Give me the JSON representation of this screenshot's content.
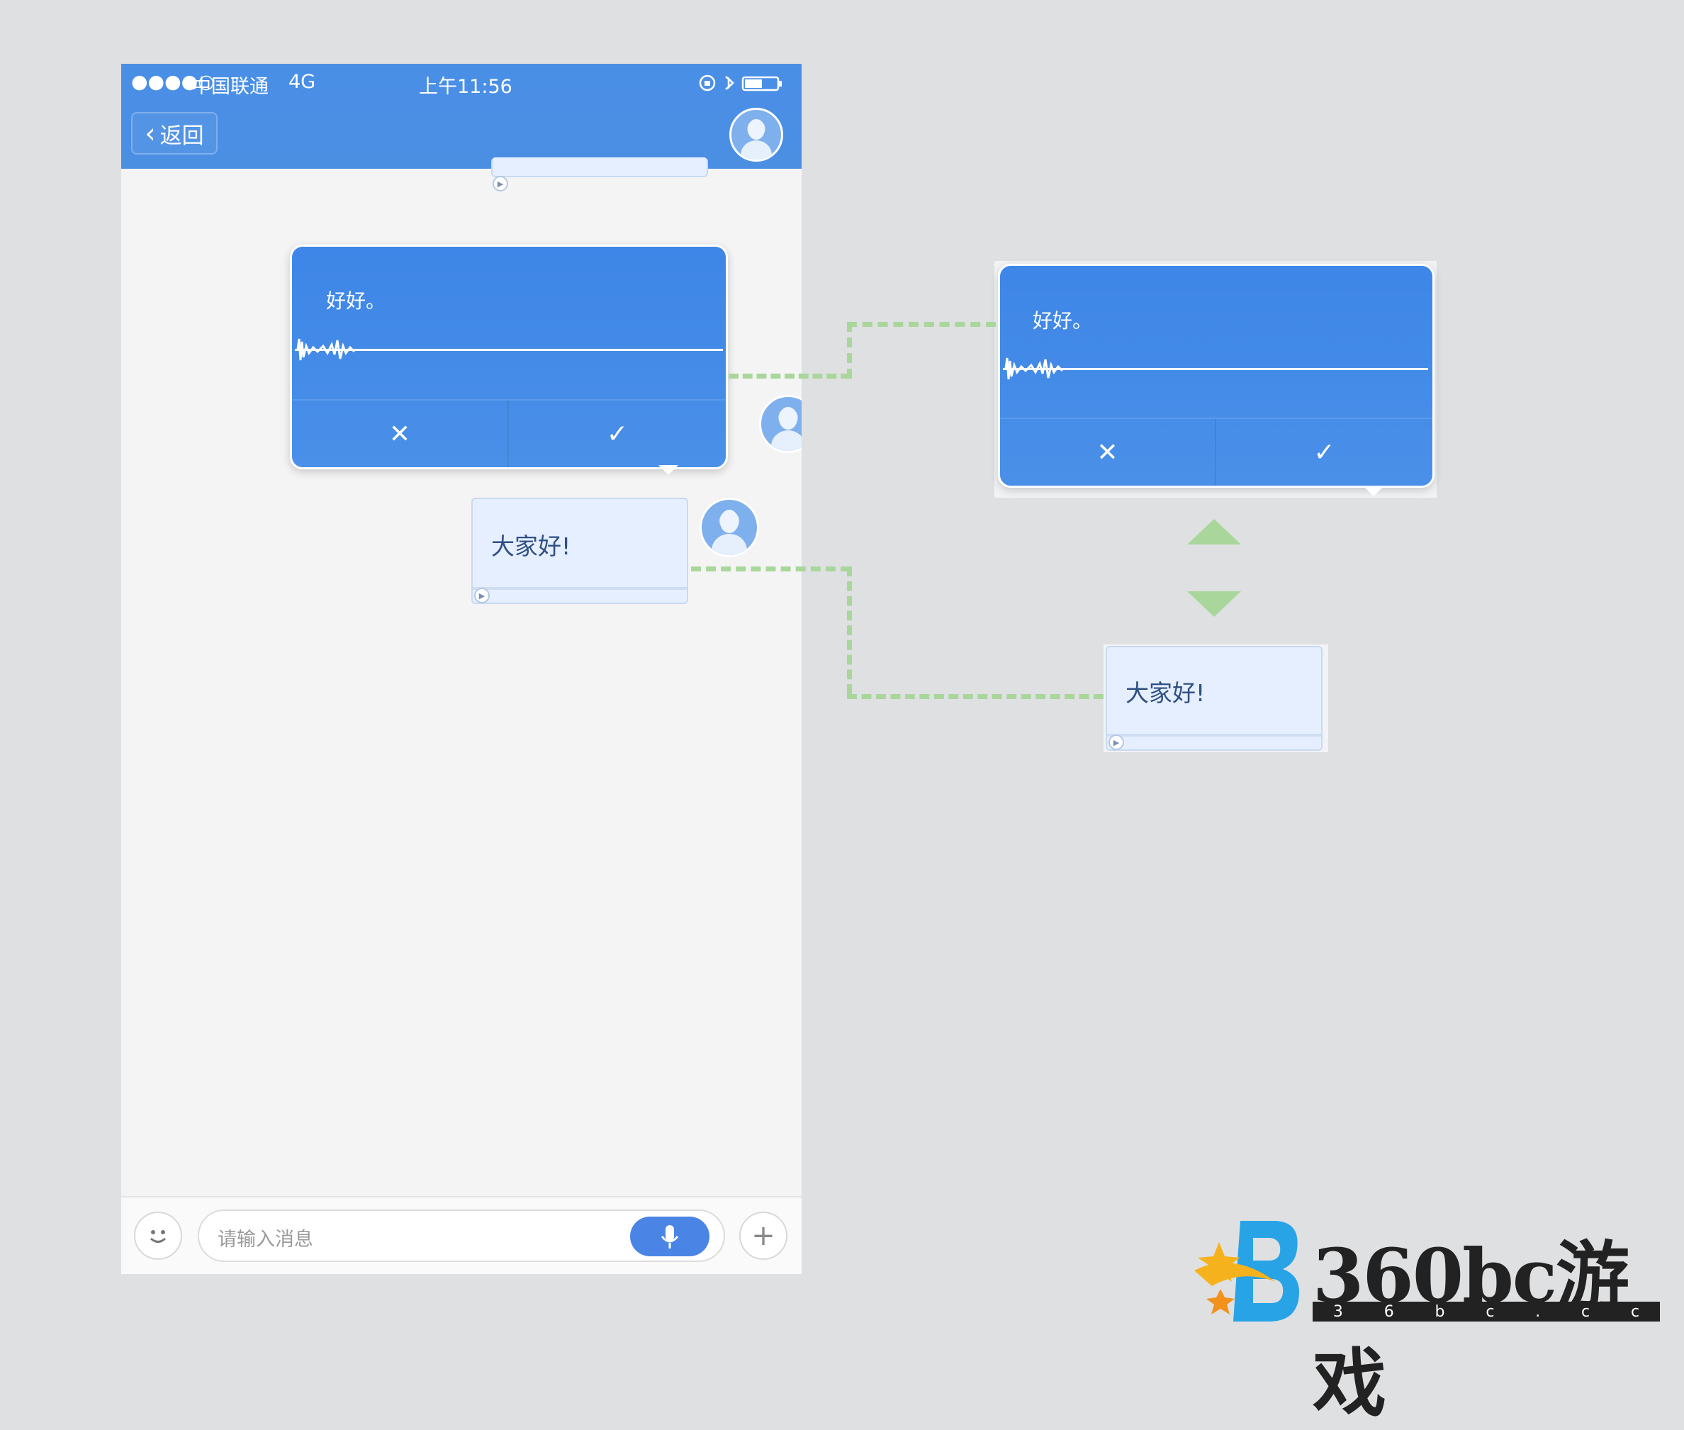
{
  "status_bar": {
    "signal": "●●●●○",
    "carrier": "中国联通",
    "network": "4G",
    "time": "上午11:56"
  },
  "nav": {
    "back_label": "返回",
    "back_chevron": "‹"
  },
  "popover": {
    "text": "好好。",
    "cancel_label": "✕",
    "confirm_label": "✓"
  },
  "message": {
    "text": "大家好!"
  },
  "input_bar": {
    "placeholder": "请输入消息",
    "emoji_icon": "smiley-icon",
    "mic_icon": "microphone-icon",
    "plus_label": "+"
  },
  "logo": {
    "name": "360bc游戏",
    "sub": [
      "3",
      "6",
      "b",
      "c",
      ".",
      "c",
      "c"
    ]
  },
  "colors": {
    "header_blue": "#4a8fe6",
    "bubble_bg": "#e6efff",
    "connector_green": "#a9d79b",
    "arrow_green": "#a9d79b"
  }
}
